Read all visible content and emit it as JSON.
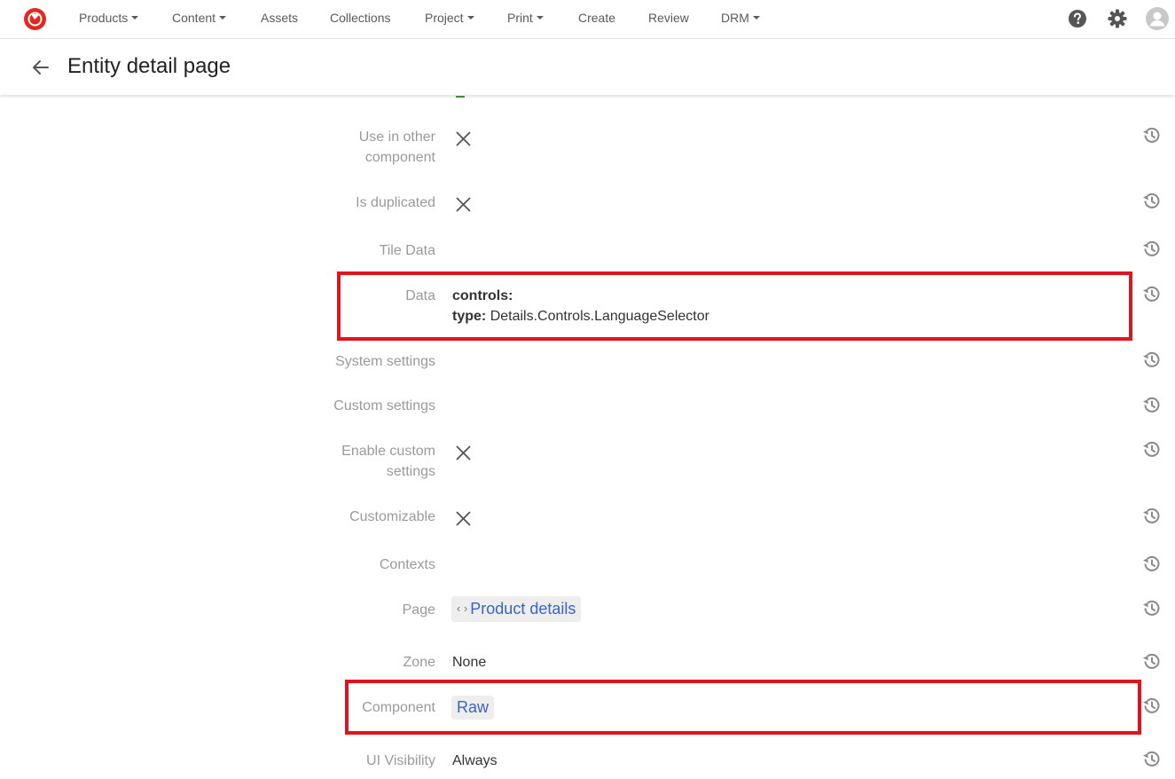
{
  "nav": {
    "items": [
      {
        "label": "Products",
        "has_caret": true
      },
      {
        "label": "Content",
        "has_caret": true
      },
      {
        "label": "Assets",
        "has_caret": false
      },
      {
        "label": "Collections",
        "has_caret": false
      },
      {
        "label": "Project",
        "has_caret": true
      },
      {
        "label": "Print",
        "has_caret": true
      },
      {
        "label": "Create",
        "has_caret": false
      },
      {
        "label": "Review",
        "has_caret": false
      },
      {
        "label": "DRM",
        "has_caret": true
      }
    ],
    "icons": [
      "logo-icon",
      "help-icon",
      "gear-icon",
      "avatar-icon"
    ]
  },
  "header": {
    "title": "Entity detail page"
  },
  "fields": {
    "use_in_other_component": {
      "label_line1": "Use in other",
      "label_line2": "component"
    },
    "is_duplicated": {
      "label": "Is duplicated"
    },
    "tile_data": {
      "label": "Tile Data"
    },
    "data": {
      "label": "Data",
      "line1_key": "controls:",
      "line2_key": "type:",
      "line2_value": "Details.Controls.LanguageSelector"
    },
    "system_settings": {
      "label": "System settings"
    },
    "custom_settings": {
      "label": "Custom settings"
    },
    "enable_custom_settings": {
      "label_line1": "Enable custom",
      "label_line2": "settings"
    },
    "customizable": {
      "label": "Customizable"
    },
    "contexts": {
      "label": "Contexts"
    },
    "page": {
      "label": "Page",
      "code_glyph": "‹ ›",
      "value": "Product details"
    },
    "zone": {
      "label": "Zone",
      "value": "None"
    },
    "component": {
      "label": "Component",
      "value": "Raw"
    },
    "ui_visibility": {
      "label": "UI Visibility",
      "value": "Always"
    }
  },
  "colors": {
    "accent_red": "#e0141e",
    "link_blue": "#3a62c9",
    "label_gray": "#9a9a9a"
  }
}
